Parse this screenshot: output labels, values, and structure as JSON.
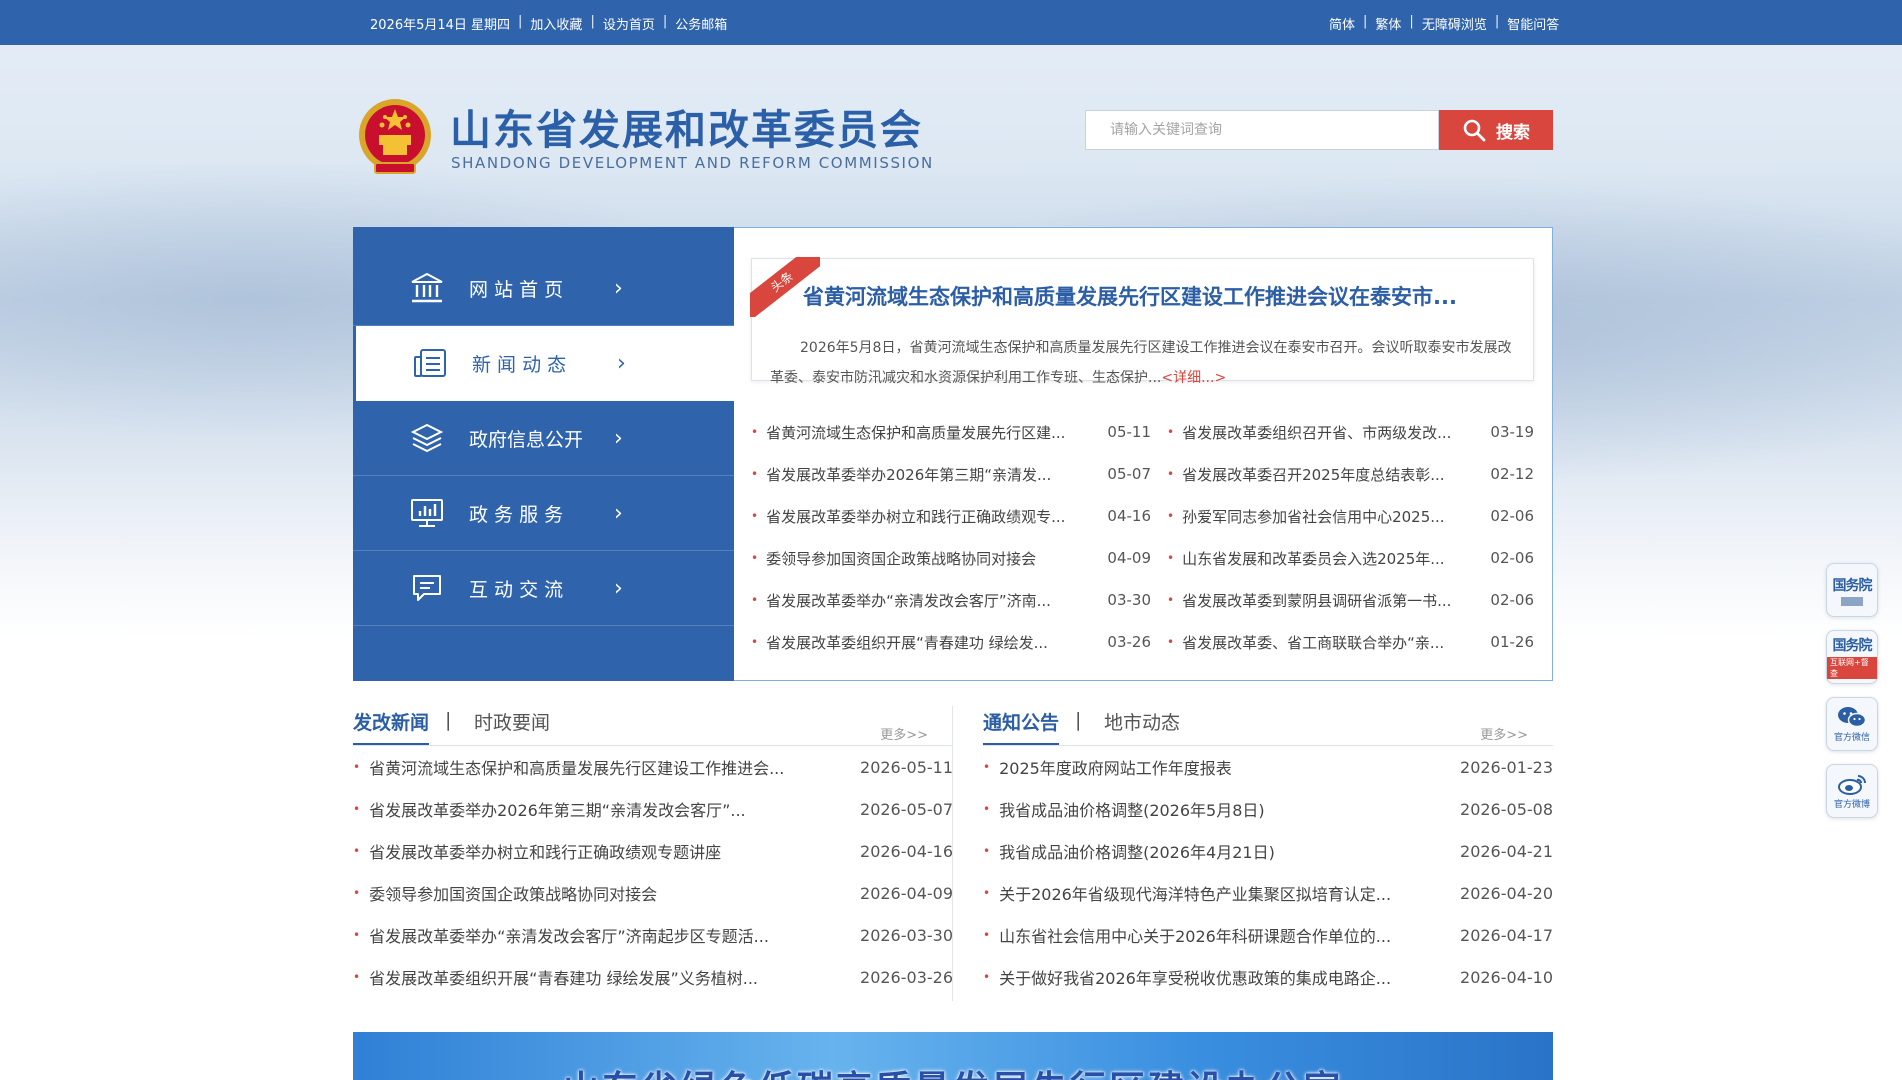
{
  "topbar": {
    "left_links": [
      "2026年5月14日 星期四",
      "加入收藏",
      "设为首页",
      "公务邮箱"
    ],
    "right_links": [
      "简体",
      "繁体",
      "无障碍浏览",
      "智能问答"
    ]
  },
  "header": {
    "title": "山东省发展和改革委员会",
    "subtitle": "SHANDONG DEVELOPMENT AND REFORM COMMISSION",
    "search_placeholder": "请输入关键词查询",
    "search_button": "搜索"
  },
  "nav": {
    "items": [
      {
        "label": "网 站 首 页",
        "icon": "building-icon"
      },
      {
        "label": "新 闻 动 态",
        "icon": "news-list-icon",
        "active": true
      },
      {
        "label": "政府信息公开",
        "icon": "layers-icon"
      },
      {
        "label": "政 务 服 务",
        "icon": "monitor-chart-icon"
      },
      {
        "label": "互 动 交 流",
        "icon": "chat-icon"
      }
    ]
  },
  "headline": {
    "ribbon": "头条",
    "title": "省黄河流域生态保护和高质量发展先行区建设工作推进会议在泰安市...",
    "summary": "2026年5月8日，省黄河流域生态保护和高质量发展先行区建设工作推进会议在泰安市召开。会议听取泰安市发展改革委、泰安市防汛减灾和水资源保护利用工作专班、生态保护...",
    "more": "<详细...>"
  },
  "news_left": [
    {
      "title": "省黄河流域生态保护和高质量发展先行区建...",
      "date": "05-11"
    },
    {
      "title": "省发展改革委举办2026年第三期“亲清发...",
      "date": "05-07"
    },
    {
      "title": "省发展改革委举办树立和践行正确政绩观专...",
      "date": "04-16"
    },
    {
      "title": "委领导参加国资国企政策战略协同对接会",
      "date": "04-09"
    },
    {
      "title": "省发展改革委举办“亲清发改会客厅”济南...",
      "date": "03-30"
    },
    {
      "title": "省发展改革委组织开展“青春建功 绿绘发...",
      "date": "03-26"
    }
  ],
  "news_right": [
    {
      "title": "省发展改革委组织召开省、市两级发改...",
      "date": "03-19"
    },
    {
      "title": "省发展改革委召开2025年度总结表彰...",
      "date": "02-12"
    },
    {
      "title": "孙爱军同志参加省社会信用中心2025...",
      "date": "02-06"
    },
    {
      "title": "山东省发展和改革委员会入选2025年...",
      "date": "02-06"
    },
    {
      "title": "省发展改革委到蒙阴县调研省派第一书...",
      "date": "02-06"
    },
    {
      "title": "省发展改革委、省工商联联合举办“亲...",
      "date": "01-26"
    }
  ],
  "section_left": {
    "tab_active": "发改新闻",
    "tab_inactive": "时政要闻",
    "separator": "|",
    "more": "更多>>",
    "items": [
      {
        "title": "省黄河流域生态保护和高质量发展先行区建设工作推进会...",
        "date": "2026-05-11"
      },
      {
        "title": "省发展改革委举办2026年第三期“亲清发改会客厅”...",
        "date": "2026-05-07"
      },
      {
        "title": "省发展改革委举办树立和践行正确政绩观专题讲座",
        "date": "2026-04-16"
      },
      {
        "title": "委领导参加国资国企政策战略协同对接会",
        "date": "2026-04-09"
      },
      {
        "title": "省发展改革委举办“亲清发改会客厅”济南起步区专题活...",
        "date": "2026-03-30"
      },
      {
        "title": "省发展改革委组织开展“青春建功 绿绘发展”义务植树...",
        "date": "2026-03-26"
      }
    ]
  },
  "section_right": {
    "tab_active": "通知公告",
    "tab_inactive": "地市动态",
    "separator": "|",
    "more": "更多>>",
    "items": [
      {
        "title": "2025年度政府网站工作年度报表",
        "date": "2026-01-23"
      },
      {
        "title": "我省成品油价格调整(2026年5月8日)",
        "date": "2026-05-08"
      },
      {
        "title": "我省成品油价格调整(2026年4月21日)",
        "date": "2026-04-21"
      },
      {
        "title": "关于2026年省级现代海洋特色产业集聚区拟培育认定...",
        "date": "2026-04-20"
      },
      {
        "title": "山东省社会信用中心关于2026年科研课题合作单位的...",
        "date": "2026-04-17"
      },
      {
        "title": "关于做好我省2026年享受税收优惠政策的集成电路企...",
        "date": "2026-04-10"
      }
    ]
  },
  "floating": [
    {
      "big": "国务院",
      "small": "",
      "icon": "gov-client-icon"
    },
    {
      "big": "国务院",
      "small": "互联网+督查",
      "icon": "gov-inspection-icon"
    },
    {
      "big": "",
      "cap": "官方微信",
      "icon": "wechat-icon"
    },
    {
      "big": "",
      "cap": "官方微博",
      "icon": "weibo-icon"
    }
  ],
  "banner": {
    "text": "山东省绿色低碳高质量发展先行区建设办公室"
  },
  "colors": {
    "primary": "#2f64ad",
    "accent_red": "#d9463e",
    "title_blue": "#2c5ea6"
  }
}
